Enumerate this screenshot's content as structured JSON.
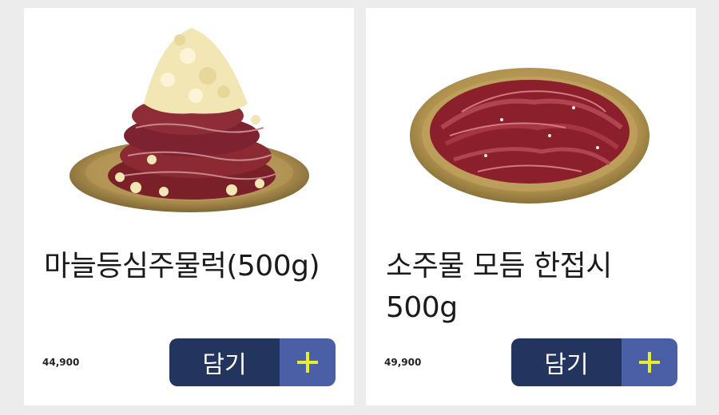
{
  "products": [
    {
      "name": "마늘등심주물럭(500g)",
      "price": "44,900",
      "add_label": "담기",
      "image": "beef-with-garlic-on-brass-plate"
    },
    {
      "name": "소주물 모듬 한접시\n500g",
      "price": "49,900",
      "add_label": "담기",
      "image": "marinated-beef-on-brass-plate"
    }
  ],
  "colors": {
    "button_dark": "#23345f",
    "button_light": "#4a5fa5",
    "plus_icon": "#e6f02a"
  }
}
